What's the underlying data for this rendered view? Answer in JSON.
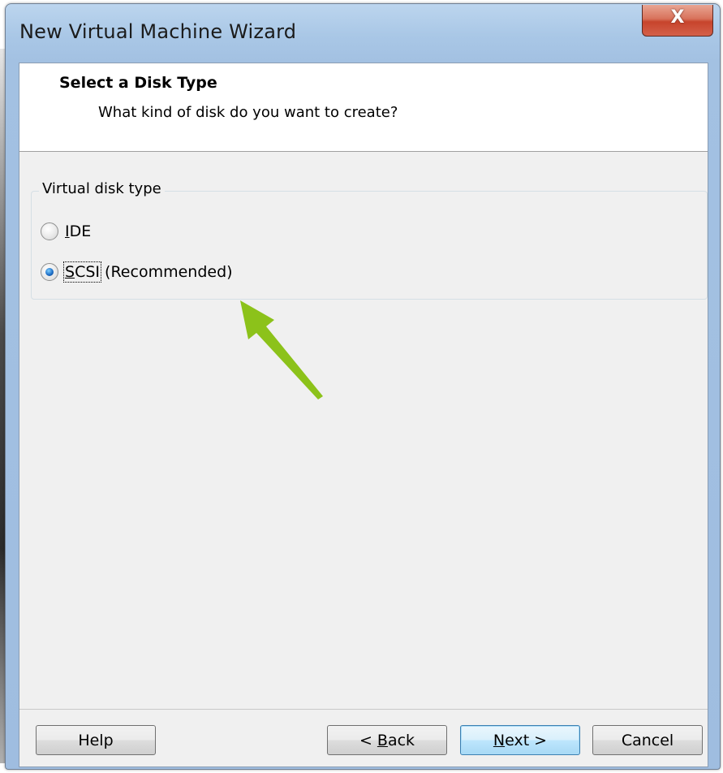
{
  "window": {
    "title": "New Virtual Machine Wizard",
    "close_glyph": "X"
  },
  "header": {
    "title": "Select a Disk Type",
    "subtitle": "What kind of disk do you want to create?"
  },
  "disk_type_group": {
    "label": "Virtual disk type",
    "options": [
      {
        "mnemonic": "I",
        "rest": "DE",
        "suffix": "",
        "checked": false
      },
      {
        "mnemonic": "S",
        "rest": "CSI",
        "suffix": "(Recommended)",
        "checked": true
      }
    ]
  },
  "buttons": {
    "help": "Help",
    "back_prefix": "< ",
    "back_mnemonic": "B",
    "back_rest": "ack",
    "next_mnemonic": "N",
    "next_rest": "ext >",
    "cancel": "Cancel"
  },
  "colors": {
    "annotation_arrow": "#8cc21a",
    "close_button": "#c7442c",
    "default_button_border": "#3c7fb1"
  },
  "icons": {
    "close": "close-icon",
    "annotation": "pointer-arrow-icon"
  }
}
